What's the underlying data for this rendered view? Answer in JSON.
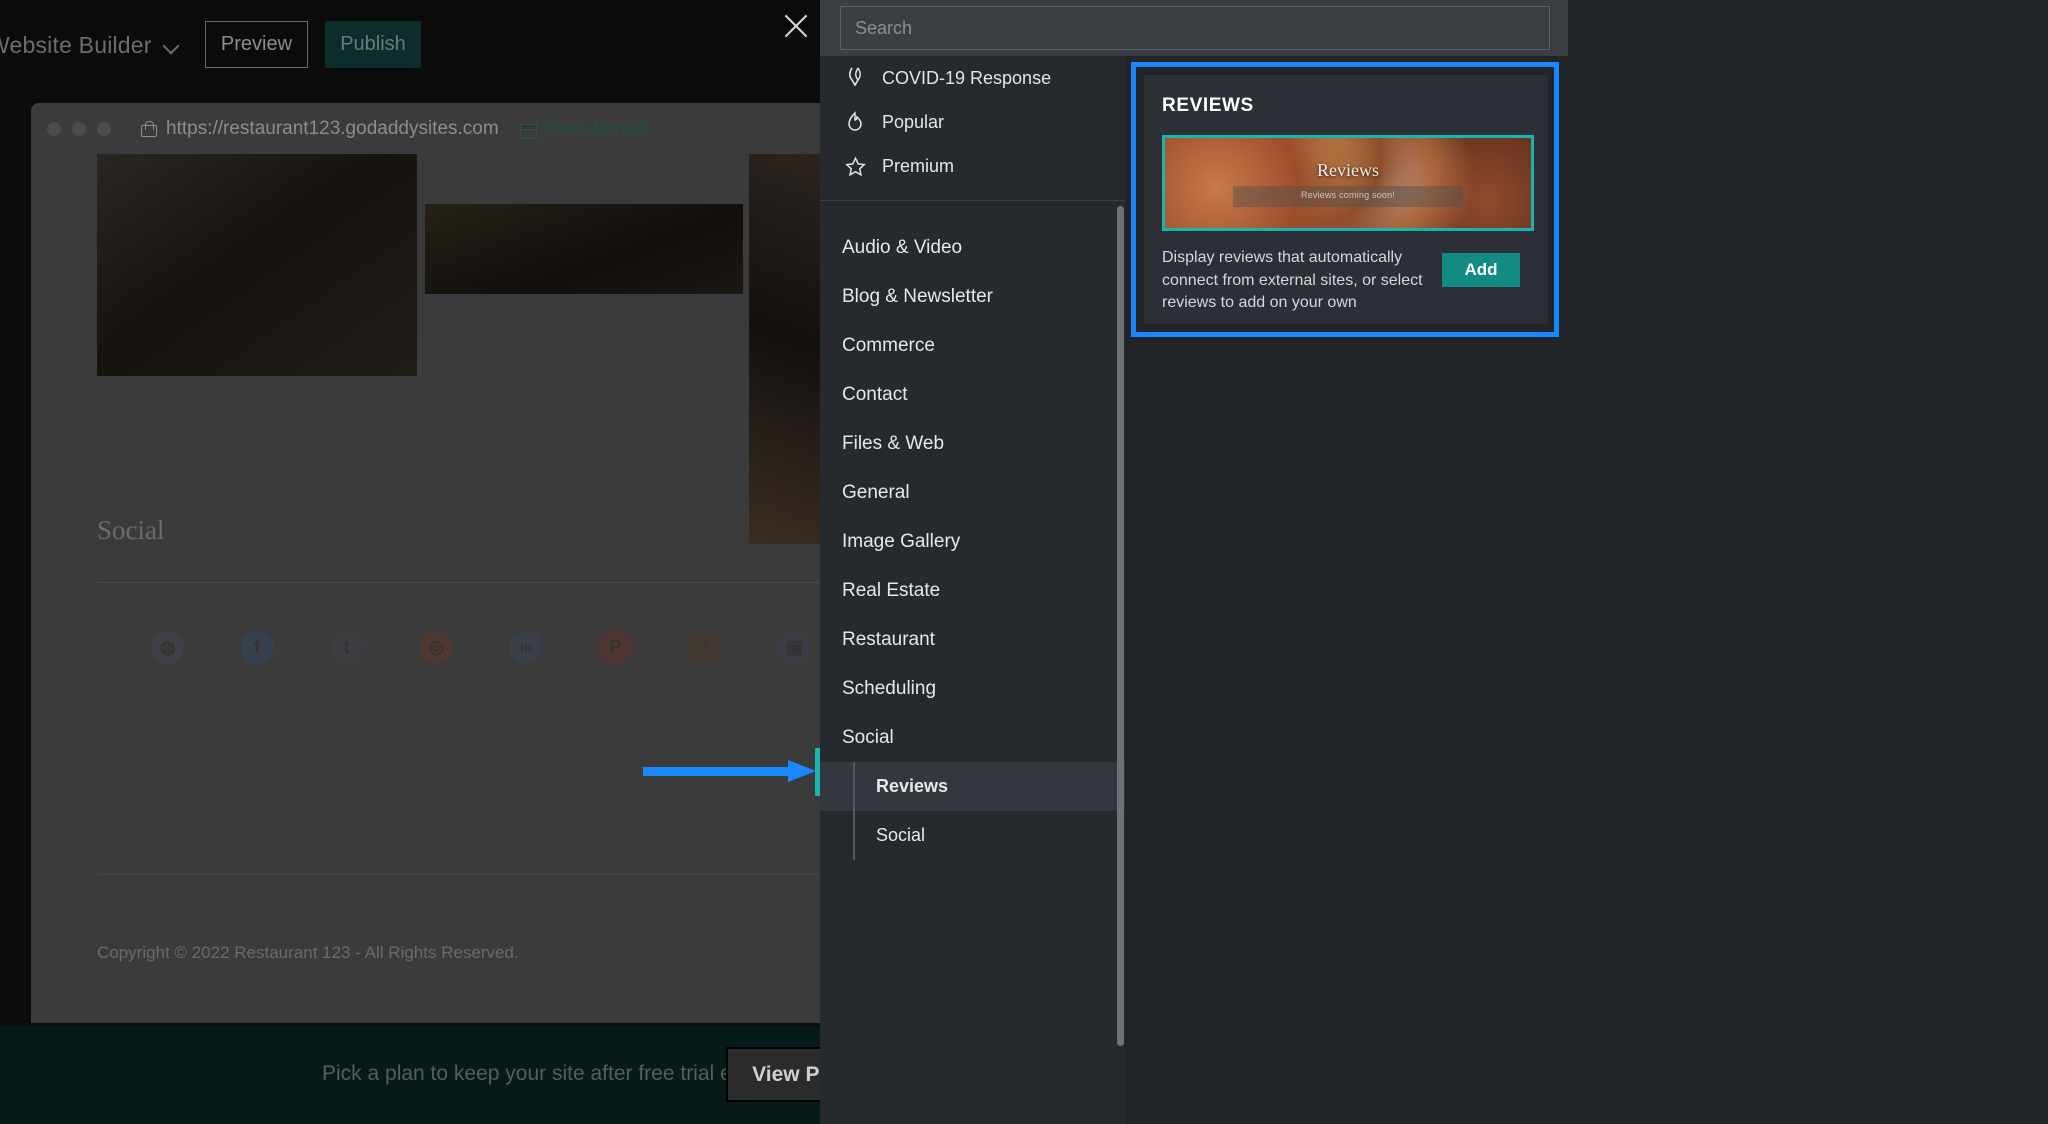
{
  "builder": {
    "brand": "Website Builder",
    "preview_label": "Preview",
    "publish_label": "Publish",
    "close_label": "×",
    "browser": {
      "url": "https://restaurant123.godaddysites.com",
      "free_domain_label": "Free domain"
    },
    "site": {
      "social_heading": "Social",
      "social_icons": [
        {
          "name": "discord",
          "glyph": "●●"
        },
        {
          "name": "facebook",
          "glyph": "f"
        },
        {
          "name": "tumblr",
          "glyph": "t"
        },
        {
          "name": "instagram",
          "glyph": "□"
        },
        {
          "name": "linkedin",
          "glyph": "in"
        },
        {
          "name": "pinterest",
          "glyph": "P"
        },
        {
          "name": "tiktok",
          "glyph": "♪"
        },
        {
          "name": "twitch",
          "glyph": "■"
        }
      ],
      "copyright": "Copyright © 2022 Restaurant 123 - All Rights Reserved."
    },
    "plan_bar": {
      "message": "Pick a plan to keep your site after free trial ends",
      "button_label": "View Plan"
    }
  },
  "panel": {
    "search": {
      "placeholder": "Search",
      "value": ""
    },
    "featured": [
      {
        "label": "COVID-19 Response",
        "icon": "ribbon-icon"
      },
      {
        "label": "Popular",
        "icon": "flame-icon"
      },
      {
        "label": "Premium",
        "icon": "star-icon"
      }
    ],
    "categories": [
      {
        "label": "Audio & Video"
      },
      {
        "label": "Blog & Newsletter"
      },
      {
        "label": "Commerce"
      },
      {
        "label": "Contact"
      },
      {
        "label": "Files & Web"
      },
      {
        "label": "General"
      },
      {
        "label": "Image Gallery"
      },
      {
        "label": "Real Estate"
      },
      {
        "label": "Restaurant"
      },
      {
        "label": "Scheduling"
      },
      {
        "label": "Social"
      }
    ],
    "subcategories": [
      {
        "label": "Reviews",
        "selected": true
      },
      {
        "label": "Social",
        "selected": false
      }
    ],
    "card": {
      "title": "REVIEWS",
      "thumb_title": "Reviews",
      "thumb_subtitle": "Reviews coming soon!",
      "description": "Display reviews that automatically connect from external sites, or select reviews to add on your own",
      "add_label": "Add"
    }
  },
  "colors": {
    "highlight_blue": "#1b87ff",
    "accent_teal": "#16b5ad",
    "add_button_teal": "#128b85",
    "panel_bg": "#212429",
    "list_bg": "#262a2f",
    "plan_bar_bg": "#061a19"
  }
}
